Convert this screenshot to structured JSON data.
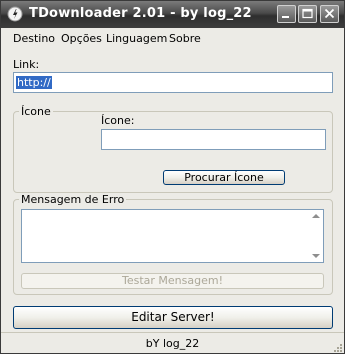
{
  "window": {
    "title": "TDownloader 2.01 - by log_22"
  },
  "menu": {
    "items": [
      "Destino",
      "Opções",
      "Linguagem",
      "Sobre"
    ]
  },
  "link": {
    "label": "Link:",
    "value": "http://"
  },
  "icon_group": {
    "title": "Ícone",
    "field_label": "Ícone:",
    "field_value": "",
    "browse_button": "Procurar Ícone"
  },
  "error_group": {
    "title": "Mensagem de Erro",
    "message_value": "",
    "test_button": "Testar Mensagem!"
  },
  "edit_button": "Editar Server!",
  "status": "bY log_22",
  "colors": {
    "selection": "#316ac5",
    "input_border": "#7f9db9",
    "button_border": "#003c74"
  }
}
